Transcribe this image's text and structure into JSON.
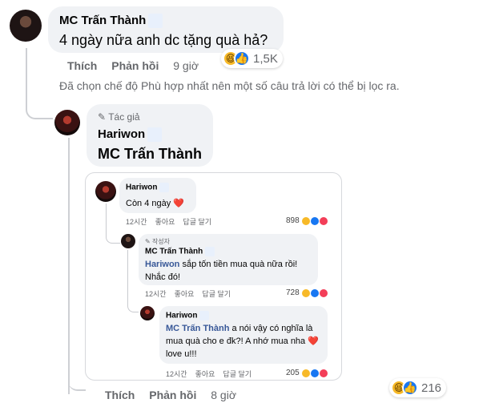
{
  "comment1": {
    "author": "MC Trấn Thành",
    "text": "4 ngày nữa anh dc tặng quà hả?",
    "like": "Thích",
    "reply": "Phản hồi",
    "time": "9 giờ",
    "reactions": "1,5K"
  },
  "filter_notice": "Đã chọn chế độ Phù hợp nhất nên một số câu trả lời có thể bị lọc ra.",
  "reply1": {
    "badge": "Tác giả",
    "author": "Hariwon",
    "mention": "MC Trấn Thành",
    "like": "Thích",
    "reply": "Phản hồi",
    "time": "8 giờ",
    "reactions": "216"
  },
  "embedded": {
    "c1": {
      "author": "Hariwon",
      "text": "Còn 4 ngày ❤️",
      "time": "12시간",
      "like": "좋아요",
      "reply": "답글 달기",
      "count": "898"
    },
    "c2": {
      "badge": "작성자",
      "author": "MC Trấn Thành",
      "mention": "Hariwon",
      "text": " sắp tốn tiền mua quà nữa rồi! Nhắc đó!",
      "time": "12시간",
      "like": "좋아요",
      "reply": "답글 달기",
      "count": "728"
    },
    "c3": {
      "author": "Hariwon",
      "mention": "MC Trấn Thành",
      "text": " a nói vậy có nghĩa là mua quà cho e đk?! A nhớ mua nha ❤️ love u!!!",
      "time": "12시간",
      "like": "좋아요",
      "reply": "답글 달기",
      "count": "205"
    }
  },
  "icons": {
    "haha": "haha-emoji",
    "like": "like-icon",
    "love": "love-icon",
    "pencil": "pencil-icon"
  }
}
